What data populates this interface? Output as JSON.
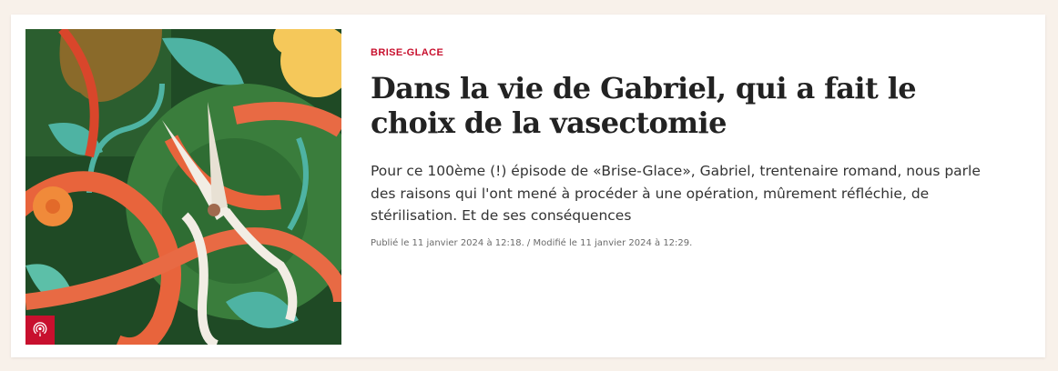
{
  "article": {
    "kicker": "BRISE-GLACE",
    "title": "Dans la vie de Gabriel, qui a fait le choix de la vasectomie",
    "lead": "Pour ce 100ème (!) épisode de «Brise-Glace», Gabriel, trentenaire romand, nous parle des raisons qui l'ont mené à procéder à une opération, mûrement réfléchie, de stérilisation. Et de ses conséquences",
    "meta": "Publié le 11 janvier 2024 à 12:18. / Modifié le 11 janvier 2024 à 12:29.",
    "image_icon": "scissors-illustration-icon",
    "badge_icon": "podcast-icon"
  },
  "colors": {
    "page_background": "#f8f1ea",
    "card_background": "#ffffff",
    "accent": "#c8102e",
    "title": "#222222",
    "lead": "#333333",
    "meta": "#6b6b6b",
    "illustration_green": "#2b5e2f",
    "illustration_orange": "#e8643c",
    "illustration_teal": "#4eb3a3",
    "illustration_yellow": "#f5c85a"
  }
}
